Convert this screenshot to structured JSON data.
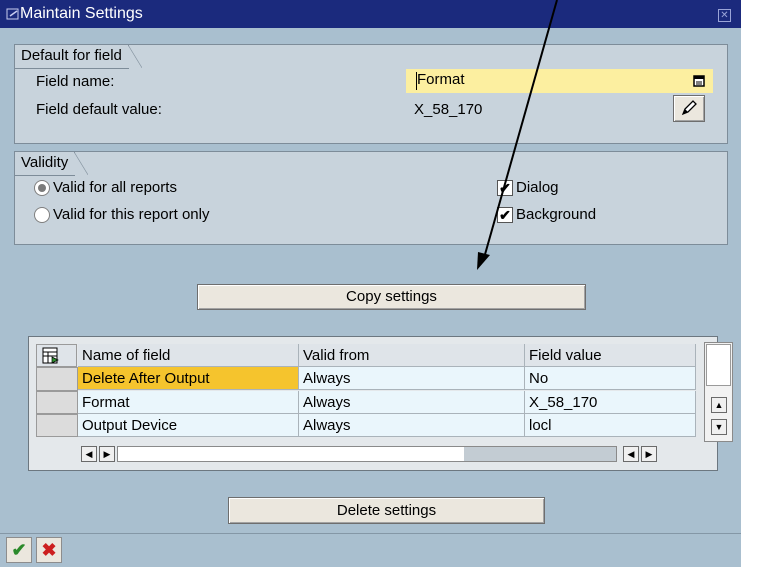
{
  "window": {
    "title": "Maintain Settings"
  },
  "default_group": {
    "title": "Default for field",
    "field_name_label": "Field name:",
    "field_name_value": "Format",
    "default_value_label": "Field default value:",
    "default_value": "X_58_170"
  },
  "validity": {
    "title": "Validity",
    "option_all": "Valid for all reports",
    "option_this": "Valid for this report only",
    "dialog_label": "Dialog",
    "background_label": "Background",
    "selected_option": "all",
    "dialog_checked": true,
    "background_checked": true
  },
  "copy_button": "Copy settings",
  "table": {
    "headers": [
      "Name of field",
      "Valid from",
      "Field value"
    ],
    "rows": [
      [
        "Delete After Output",
        "Always",
        "No"
      ],
      [
        "Format",
        "Always",
        "X_58_170"
      ],
      [
        "Output Device",
        "Always",
        "locl"
      ]
    ]
  },
  "delete_button": "Delete settings",
  "colors": {
    "title_bar": "#1b2a7d",
    "dialog_bg": "#a9bfcf",
    "field_highlight": "#fcefa0",
    "selected_cell": "#f5c42d"
  },
  "icons": [
    "window-icon",
    "close-icon",
    "f4-help-icon",
    "edit-pencil-icon",
    "table-settings-icon",
    "arrow-annotation-icon",
    "confirm-icon",
    "cancel-icon"
  ]
}
